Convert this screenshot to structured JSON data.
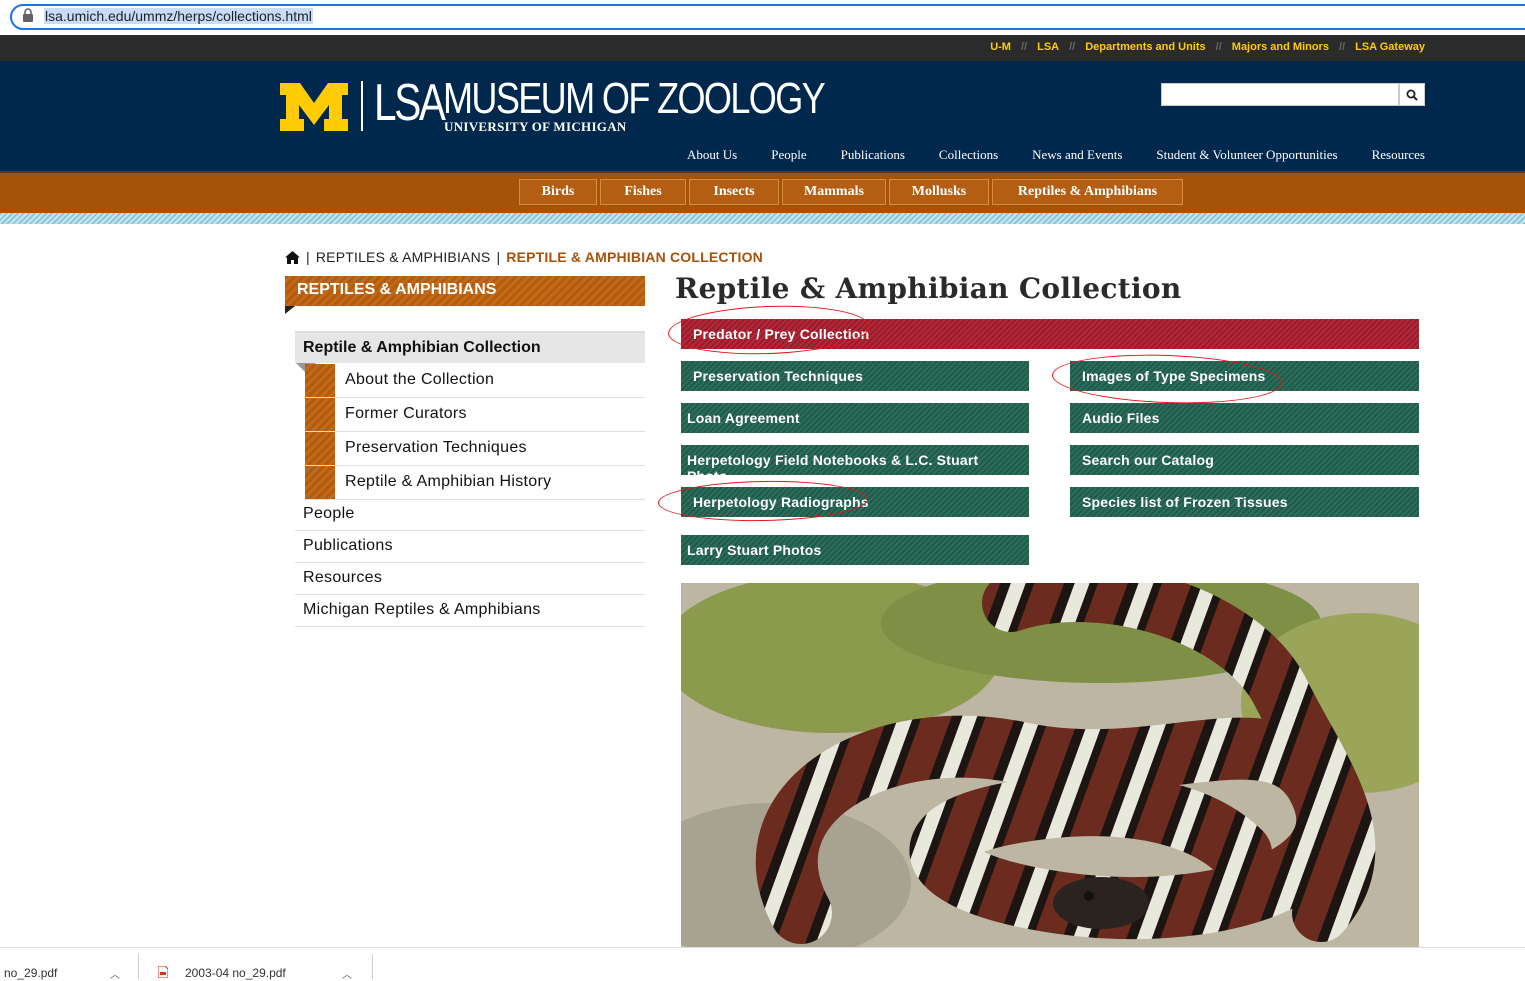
{
  "browser": {
    "url": "lsa.umich.edu/ummz/herps/collections.html"
  },
  "utility_nav": [
    "U-M",
    "LSA",
    "Departments and Units",
    "Majors and Minors",
    "LSA Gateway"
  ],
  "header": {
    "logo_lsa": "LSA",
    "logo_title": "MUSEUM OF ZOOLOGY",
    "logo_subtitle": "UNIVERSITY OF MICHIGAN",
    "search_placeholder": ""
  },
  "main_nav": [
    "About Us",
    "People",
    "Publications",
    "Collections",
    "News and Events",
    "Student & Volunteer Opportunities",
    "Resources"
  ],
  "collection_tabs": [
    "Birds",
    "Fishes",
    "Insects",
    "Mammals",
    "Mollusks",
    "Reptiles & Amphibians"
  ],
  "breadcrumb": {
    "section": "REPTILES & AMPHIBIANS",
    "current": "REPTILE & AMPHIBIAN COLLECTION"
  },
  "sidebar": {
    "heading": "REPTILES & AMPHIBIANS",
    "active": "Reptile & Amphibian Collection",
    "sub_items": [
      "About the Collection",
      "Former Curators",
      "Preservation Techniques",
      "Reptile & Amphibian History"
    ],
    "top_items": [
      "People",
      "Publications",
      "Resources",
      "Michigan Reptiles & Amphibians"
    ]
  },
  "main": {
    "title": "Reptile & Amphibian Collection",
    "featured_button": "Predator / Prey Collection",
    "buttons_left": [
      "Preservation Techniques",
      "Loan Agreement",
      "Herpetology Field Notebooks & L.C. Stuart Photo",
      "Herpetology Radiographs",
      "Larry Stuart Photos"
    ],
    "buttons_right": [
      "Images of Type Specimens",
      "Audio Files",
      "Search our Catalog",
      "Species list of Frozen Tissues"
    ]
  },
  "downloads": [
    "no_29.pdf",
    "2003-04 no_29.pdf"
  ],
  "colors": {
    "header_blue": "#00274c",
    "maize": "#ffcb05",
    "orange": "#a5520a",
    "green": "#2e6d5c",
    "red": "#b02a3a"
  }
}
